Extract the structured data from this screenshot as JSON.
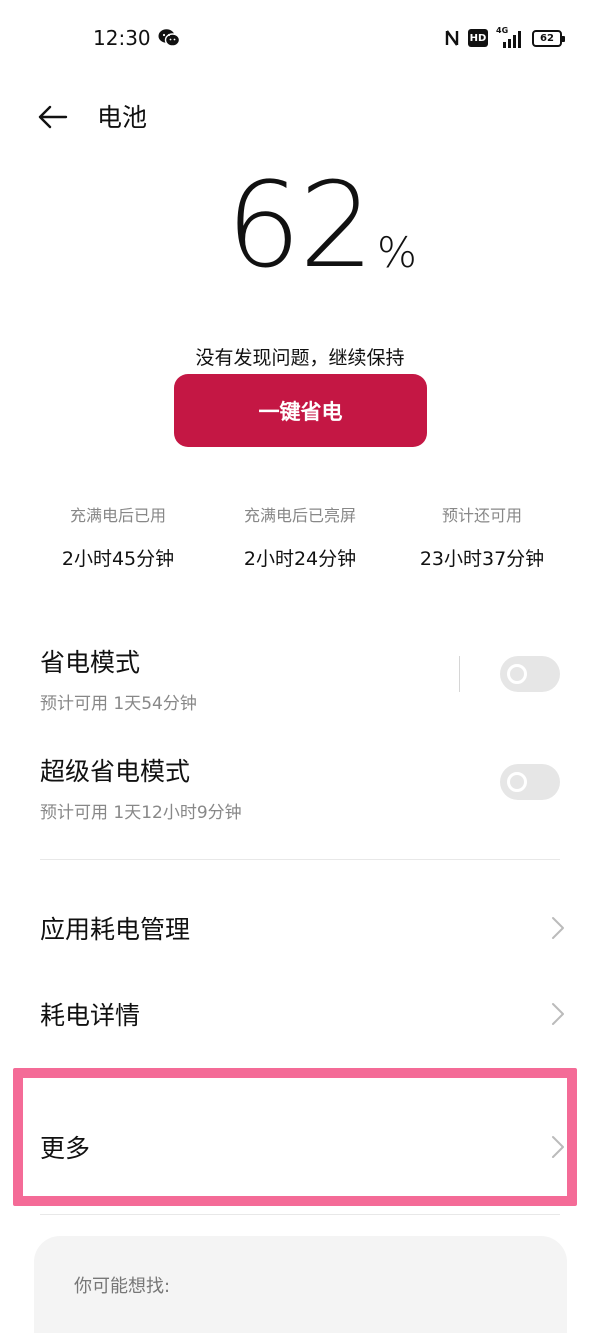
{
  "status_bar": {
    "time": "12:30",
    "hd_label": "HD",
    "network_label": "4G",
    "battery_level": "62",
    "icons": [
      "wechat-icon",
      "nfc-icon",
      "hd-icon",
      "signal-icon",
      "battery-icon"
    ]
  },
  "header": {
    "title": "电池",
    "back_icon": "arrow-left-icon"
  },
  "battery": {
    "percent": "62",
    "percent_sign": "%",
    "status_message": "没有发现问题，继续保持",
    "save_button_label": "一键省电",
    "accent_color": "#c41744"
  },
  "stats": [
    {
      "label": "充满电后已用",
      "value": "2小时45分钟"
    },
    {
      "label": "充满电后已亮屏",
      "value": "2小时24分钟"
    },
    {
      "label": "预计还可用",
      "value": "23小时37分钟"
    }
  ],
  "power_modes": [
    {
      "title": "省电模式",
      "subtitle": "预计可用 1天54分钟",
      "enabled": false
    },
    {
      "title": "超级省电模式",
      "subtitle": "预计可用 1天12小时9分钟",
      "enabled": false
    }
  ],
  "nav_items": [
    {
      "label": "应用耗电管理"
    },
    {
      "label": "耗电详情"
    },
    {
      "label": "更多"
    }
  ],
  "suggest": {
    "title": "你可能想找:"
  },
  "highlight_color": "#f46b97"
}
